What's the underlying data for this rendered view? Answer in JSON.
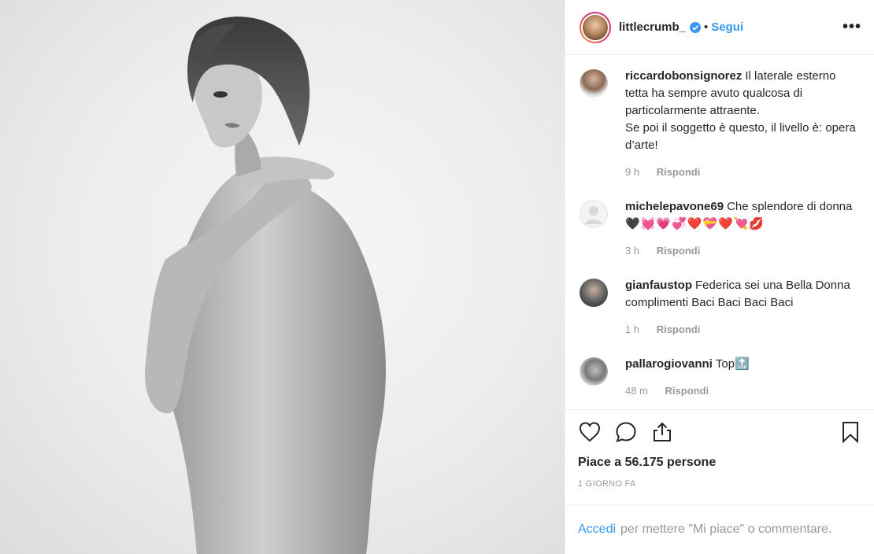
{
  "header": {
    "username": "littlecrumb_",
    "separator": "•",
    "follow_label": "Segui",
    "more_label": "•••"
  },
  "comments": [
    {
      "username": "riccardobonsignorez",
      "text": "Il laterale esterno tetta ha sempre avuto qualcosa di particolarmente attraente.",
      "text2": "Se poi il soggetto è questo, il livello è: opera d’arte!",
      "time": "9 h",
      "reply": "Rispondi"
    },
    {
      "username": "michelepavone69",
      "text": "Che splendore di donna",
      "emoji": "🖤💓💗💞❤️💝❤️💘💋",
      "time": "3 h",
      "reply": "Rispondi"
    },
    {
      "username": "gianfaustop",
      "text": "Federica sei una Bella Donna complimenti Baci Baci Baci Baci",
      "time": "1 h",
      "reply": "Rispondi"
    },
    {
      "username": "pallarogiovanni",
      "text": "Top🔝",
      "time": "48 m",
      "reply": "Rispondi"
    }
  ],
  "actions": {
    "likes": "Piace a 56.175 persone",
    "timestamp": "1 GIORNO FA",
    "icons": [
      "heart-icon",
      "comment-icon",
      "share-icon",
      "bookmark-icon"
    ]
  },
  "login": {
    "link": "Accedi",
    "text": "per mettere \"Mi piace\" o commentare."
  },
  "colors": {
    "accent": "#3897f0",
    "text": "#262626",
    "muted": "#999999"
  }
}
